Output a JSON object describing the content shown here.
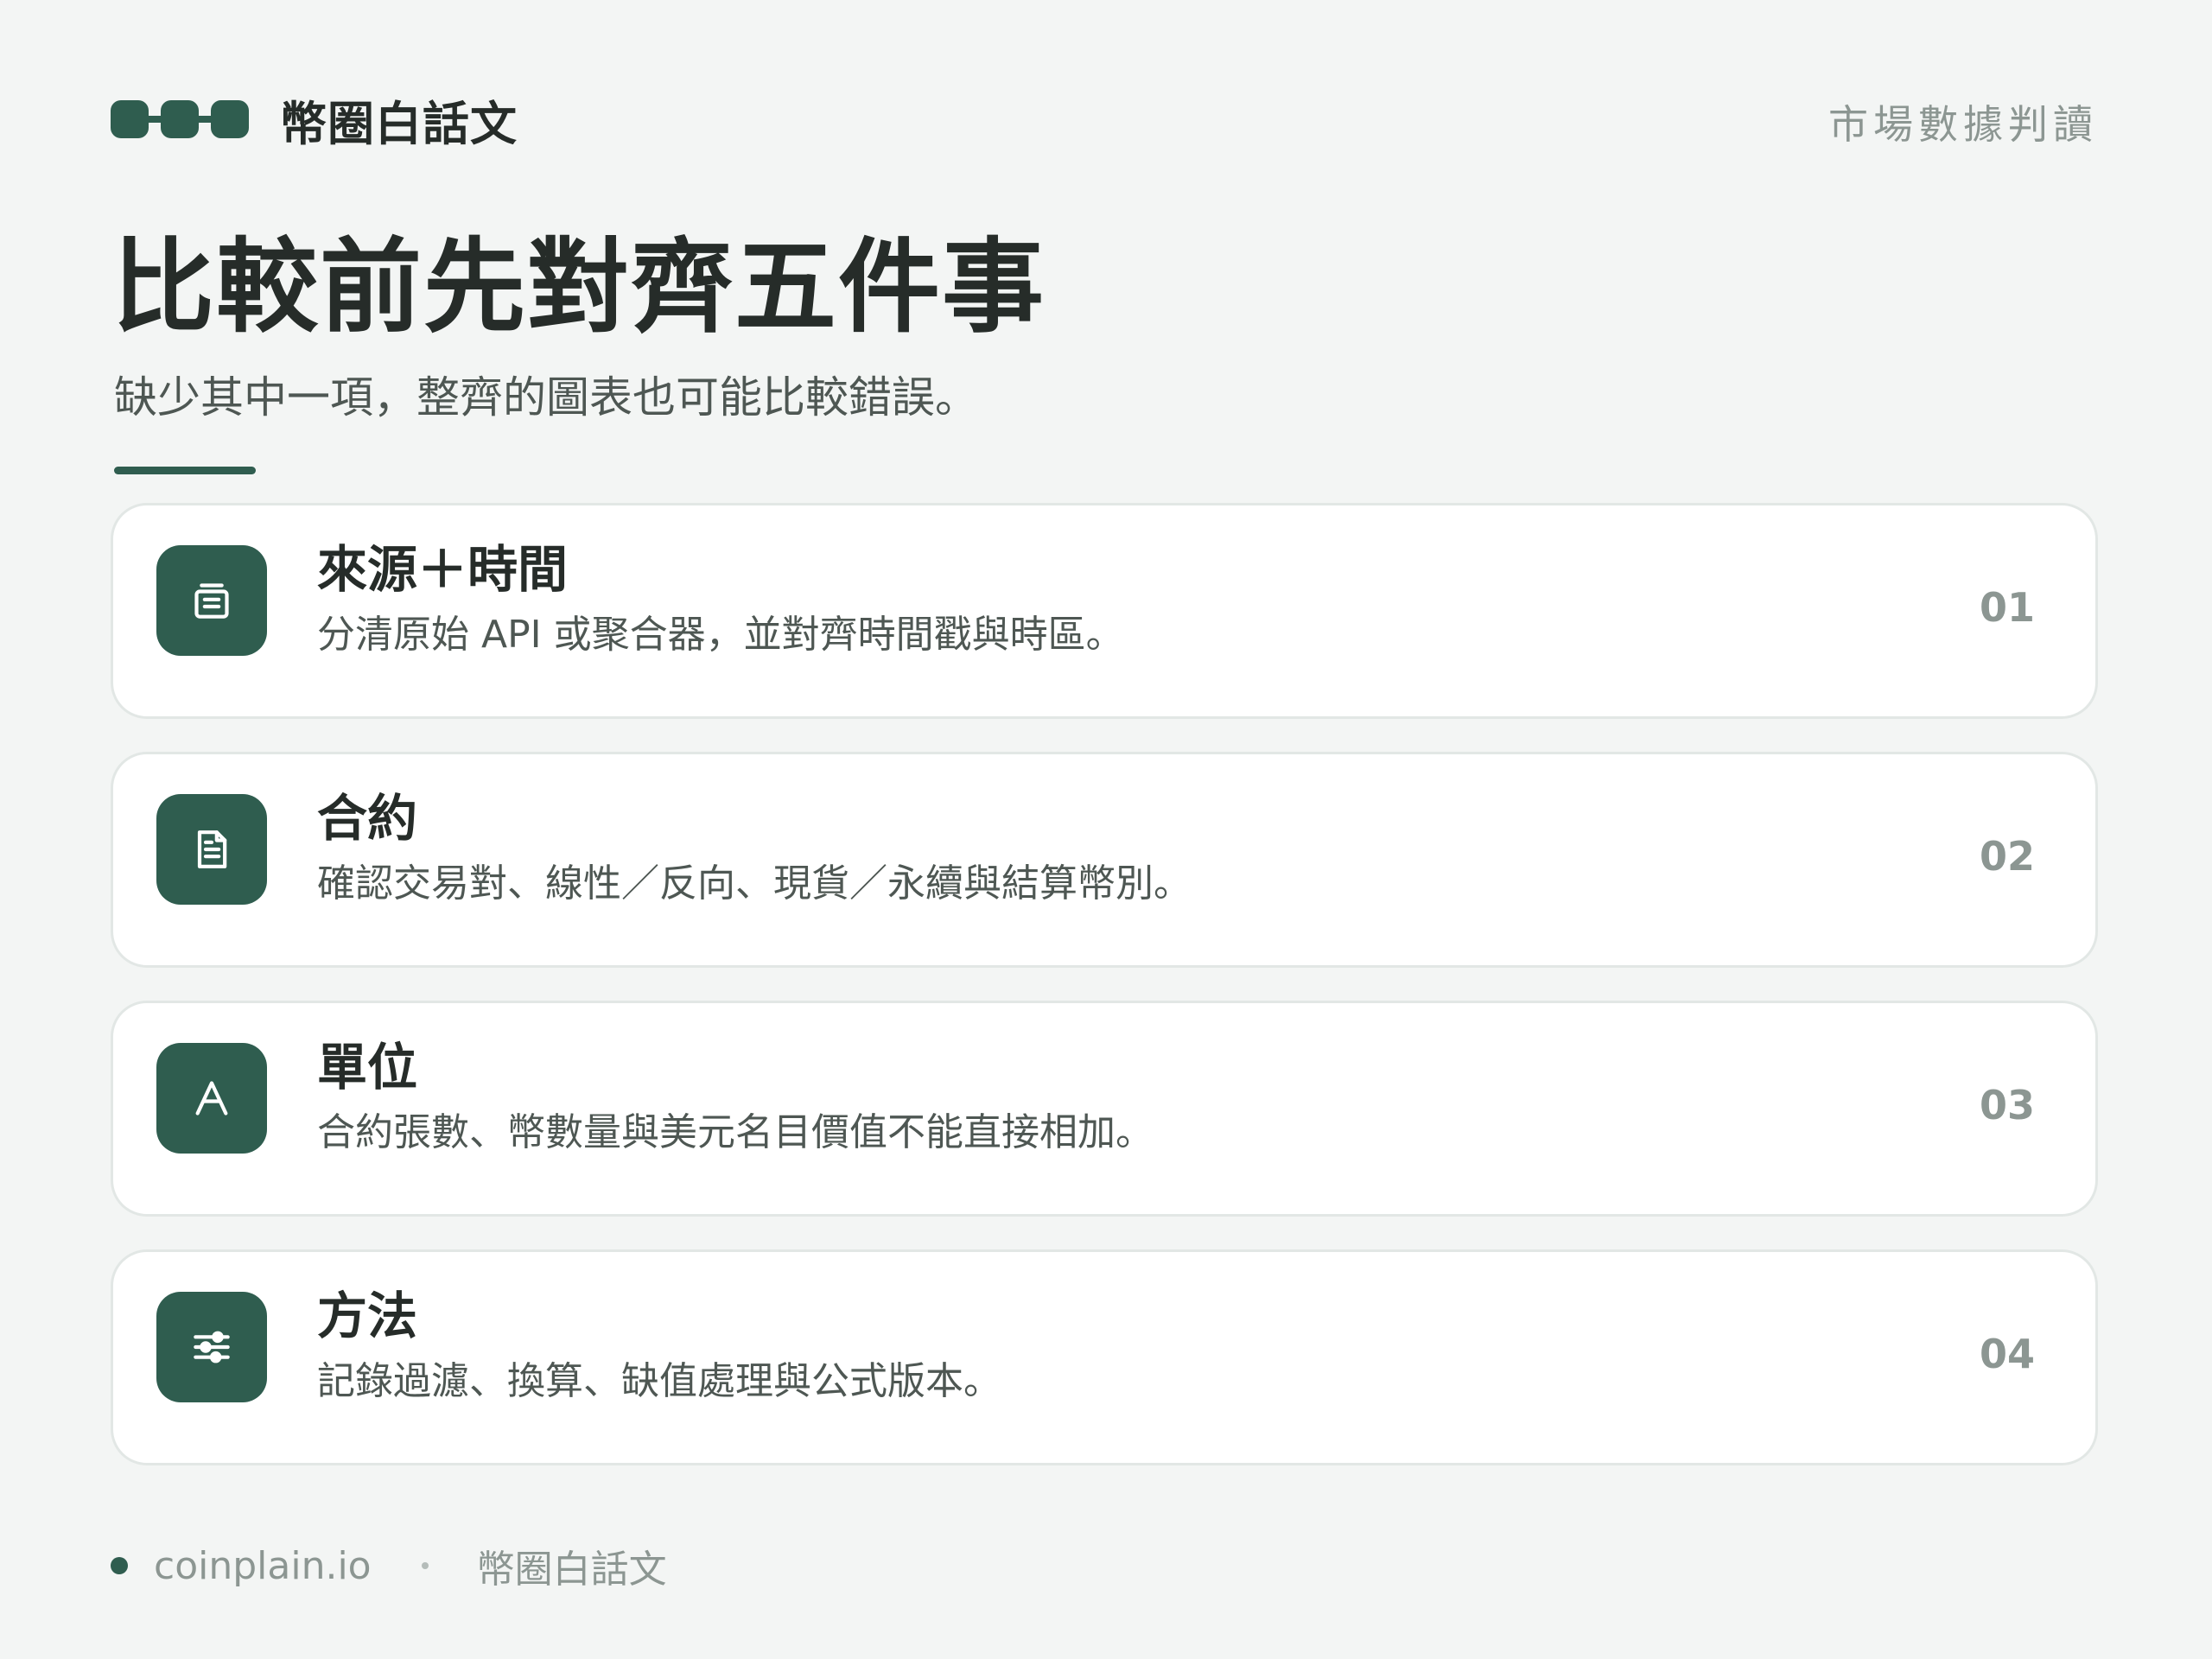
{
  "header": {
    "brand_name": "幣圈白話文",
    "tag": "市場數據判讀"
  },
  "main": {
    "title": "比較前先對齊五件事",
    "subtitle": "缺少其中一項，整齊的圖表也可能比較錯誤。"
  },
  "cards": [
    {
      "title": "來源＋時間",
      "description": "分清原始 API 或聚合器，並對齊時間戳與時區。",
      "number": "01",
      "icon": "archive-icon"
    },
    {
      "title": "合約",
      "description": "確認交易對、線性／反向、現貨／永續與結算幣別。",
      "number": "02",
      "icon": "document-icon"
    },
    {
      "title": "單位",
      "description": "合約張數、幣數量與美元名目價值不能直接相加。",
      "number": "03",
      "icon": "letter-a-icon"
    },
    {
      "title": "方法",
      "description": "記錄過濾、換算、缺值處理與公式版本。",
      "number": "04",
      "icon": "sliders-icon"
    }
  ],
  "footer": {
    "site": "coinplain.io",
    "brand": "幣圈白話文"
  },
  "colors": {
    "accent": "#2f5d4f",
    "background": "#f3f5f4",
    "card": "#ffffff",
    "muted_text": "#8c9692"
  }
}
